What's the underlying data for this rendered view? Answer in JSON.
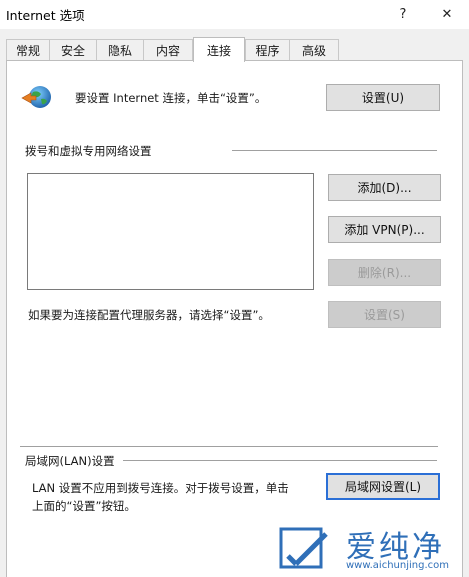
{
  "window": {
    "title": "Internet 选项",
    "help_glyph": "?",
    "close_glyph": "✕"
  },
  "tabs": [
    {
      "label": "常规"
    },
    {
      "label": "安全"
    },
    {
      "label": "隐私"
    },
    {
      "label": "内容"
    },
    {
      "label": "连接"
    },
    {
      "label": "程序"
    },
    {
      "label": "高级"
    }
  ],
  "active_tab": "连接",
  "setup": {
    "text": "要设置 Internet 连接，单击“设置”。",
    "button": "设置(U)"
  },
  "dialup": {
    "section_title": "拨号和虚拟专用网络设置",
    "add_button": "添加(D)...",
    "add_vpn_button": "添加 VPN(P)...",
    "remove_button": "删除(R)...",
    "settings_button": "设置(S)",
    "proxy_hint": "如果要为连接配置代理服务器，请选择“设置”。"
  },
  "lan": {
    "section_title": "局域网(LAN)设置",
    "text_line1": "LAN 设置不应用到拨号连接。对于拨号设置，单击",
    "text_line2": "上面的“设置”按钮。",
    "button": "局域网设置(L)"
  },
  "watermark": {
    "brand": "爱纯净",
    "url": "www.aichunjing.com"
  },
  "colors": {
    "focus_border": "#2b6fd6",
    "watermark": "#2f6fb8"
  }
}
